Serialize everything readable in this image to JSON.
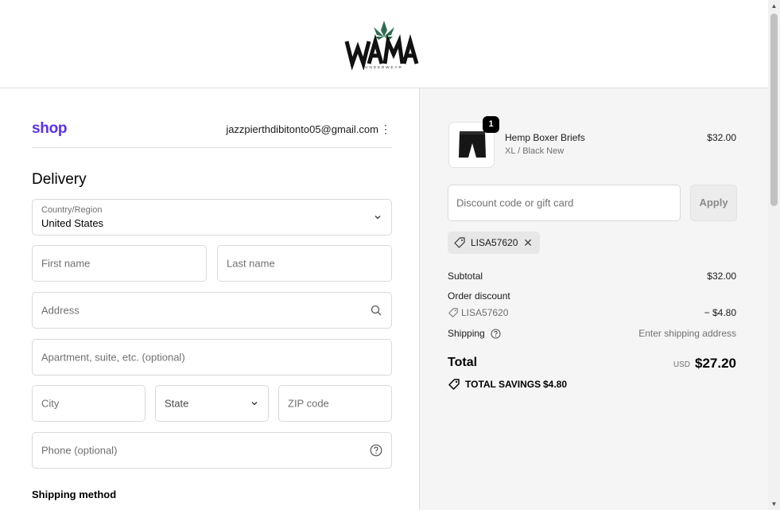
{
  "brand": {
    "name": "WAMA",
    "tagline": "UNDERWEAR",
    "leaf_color": "#2e6b4f"
  },
  "account": {
    "shop_label": "shop",
    "email": "jazzpierthdibitonto05@gmail.com",
    "menu_icon": "kebab-icon"
  },
  "delivery": {
    "title": "Delivery",
    "country_label": "Country/Region",
    "country_value": "United States",
    "first_name_placeholder": "First name",
    "last_name_placeholder": "Last name",
    "address_placeholder": "Address",
    "apartment_placeholder": "Apartment, suite, etc. (optional)",
    "city_placeholder": "City",
    "state_placeholder": "State",
    "zip_placeholder": "ZIP code",
    "phone_placeholder": "Phone (optional)"
  },
  "shipping_method": {
    "title": "Shipping method"
  },
  "order": {
    "item": {
      "quantity": "1",
      "name": "Hemp Boxer Briefs",
      "variant": "XL / Black New",
      "price": "$32.00"
    },
    "discount_placeholder": "Discount code or gift card",
    "apply_label": "Apply",
    "applied_code": "LISA57620",
    "subtotal_label": "Subtotal",
    "subtotal_value": "$32.00",
    "order_discount_label": "Order discount",
    "order_discount_code": "LISA57620",
    "order_discount_value": "− $4.80",
    "shipping_label": "Shipping",
    "shipping_value": "Enter shipping address",
    "total_label": "Total",
    "total_currency": "USD",
    "total_value": "$27.20",
    "savings_label": "TOTAL SAVINGS",
    "savings_value": "$4.80"
  },
  "colors": {
    "shop_brand": "#5a31f4",
    "sidebar_bg": "#f5f5f5",
    "border": "#d9d9d9"
  }
}
